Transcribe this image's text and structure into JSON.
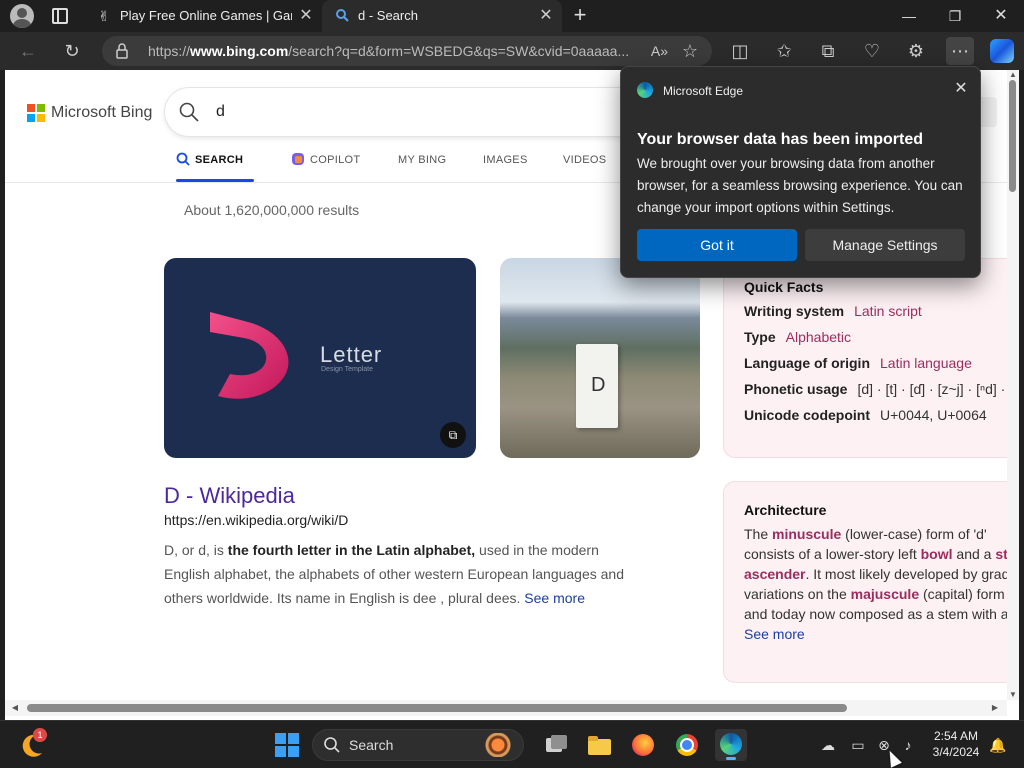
{
  "browser": {
    "tabs": [
      {
        "title": "Play Free Online Games | Games",
        "active": false
      },
      {
        "title": "d - Search",
        "active": true
      }
    ],
    "address": {
      "prefix": "https://",
      "domain": "www.bing.com",
      "path": "/search?q=d&form=WSBEDG&qs=SW&cvid=0aaaaa..."
    },
    "window_controls": {
      "minimize": "—",
      "maximize": "❐",
      "close": "✕"
    }
  },
  "bing": {
    "logo_text": "Microsoft Bing",
    "query": "d",
    "nav_tabs": [
      {
        "label": "SEARCH",
        "active": true
      },
      {
        "label": "COPILOT",
        "active": false
      },
      {
        "label": "MY BING",
        "active": false
      },
      {
        "label": "IMAGES",
        "active": false
      },
      {
        "label": "VIDEOS",
        "active": false
      }
    ],
    "result_count": "About 1,620,000,000 results",
    "image_card_text": {
      "title": "Letter",
      "subtitle": "Design Template"
    },
    "image_card_post_letter": "D",
    "result": {
      "title": "D - Wikipedia",
      "url": "https://en.wikipedia.org/wiki/D",
      "snippet_pre": "D, or d, is ",
      "snippet_bold": "the fourth letter in the Latin alphabet,",
      "snippet_post": " used in the modern English alphabet, the alphabets of other western European languages and others worldwide. Its name in English is dee , plural dees. ",
      "see_more": "See more"
    },
    "quick_facts": {
      "title": "Quick Facts",
      "rows": [
        {
          "key": "Writing system",
          "value": "Latin script",
          "link": true
        },
        {
          "key": "Type",
          "value": "Alphabetic",
          "link": true
        },
        {
          "key": "Language of origin",
          "value": "Latin language",
          "link": true
        },
        {
          "key": "Phonetic usage",
          "value": "[d] · [t] · [ɗ] · [z~j] · [ⁿd] · [",
          "link": false
        },
        {
          "key": "Unicode codepoint",
          "value": "U+0044, U+0064",
          "link": false
        }
      ]
    },
    "architecture": {
      "title": "Architecture",
      "parts": [
        {
          "text": "The ",
          "hl": false
        },
        {
          "text": "minuscule",
          "hl": true
        },
        {
          "text": " (lower-case) form of 'd' consists of a lower-story left ",
          "hl": false
        },
        {
          "text": "bowl",
          "hl": true
        },
        {
          "text": " and a ",
          "hl": false
        },
        {
          "text": "stem ascender",
          "hl": true
        },
        {
          "text": ". It most likely developed by gradual variations on the ",
          "hl": false
        },
        {
          "text": "majuscule",
          "hl": true
        },
        {
          "text": " (capital) form 'D', and today now composed as a stem with a ... ",
          "hl": false
        }
      ],
      "see_more": "See more"
    }
  },
  "popup": {
    "app_name": "Microsoft Edge",
    "title": "Your browser data has been imported",
    "body": "We brought over your browsing data from another browser, for a seamless browsing experience. You can change your import options within Settings.",
    "primary_button": "Got it",
    "secondary_button": "Manage Settings"
  },
  "taskbar": {
    "search_label": "Search",
    "widget_badge": "1",
    "time": "2:54 AM",
    "date": "3/4/2024"
  },
  "colors": {
    "accent": "#0067c0",
    "bing_tab_underline": "#174ae4",
    "link_purple": "#4c2a9e",
    "fact_link": "#9b2c5d"
  }
}
